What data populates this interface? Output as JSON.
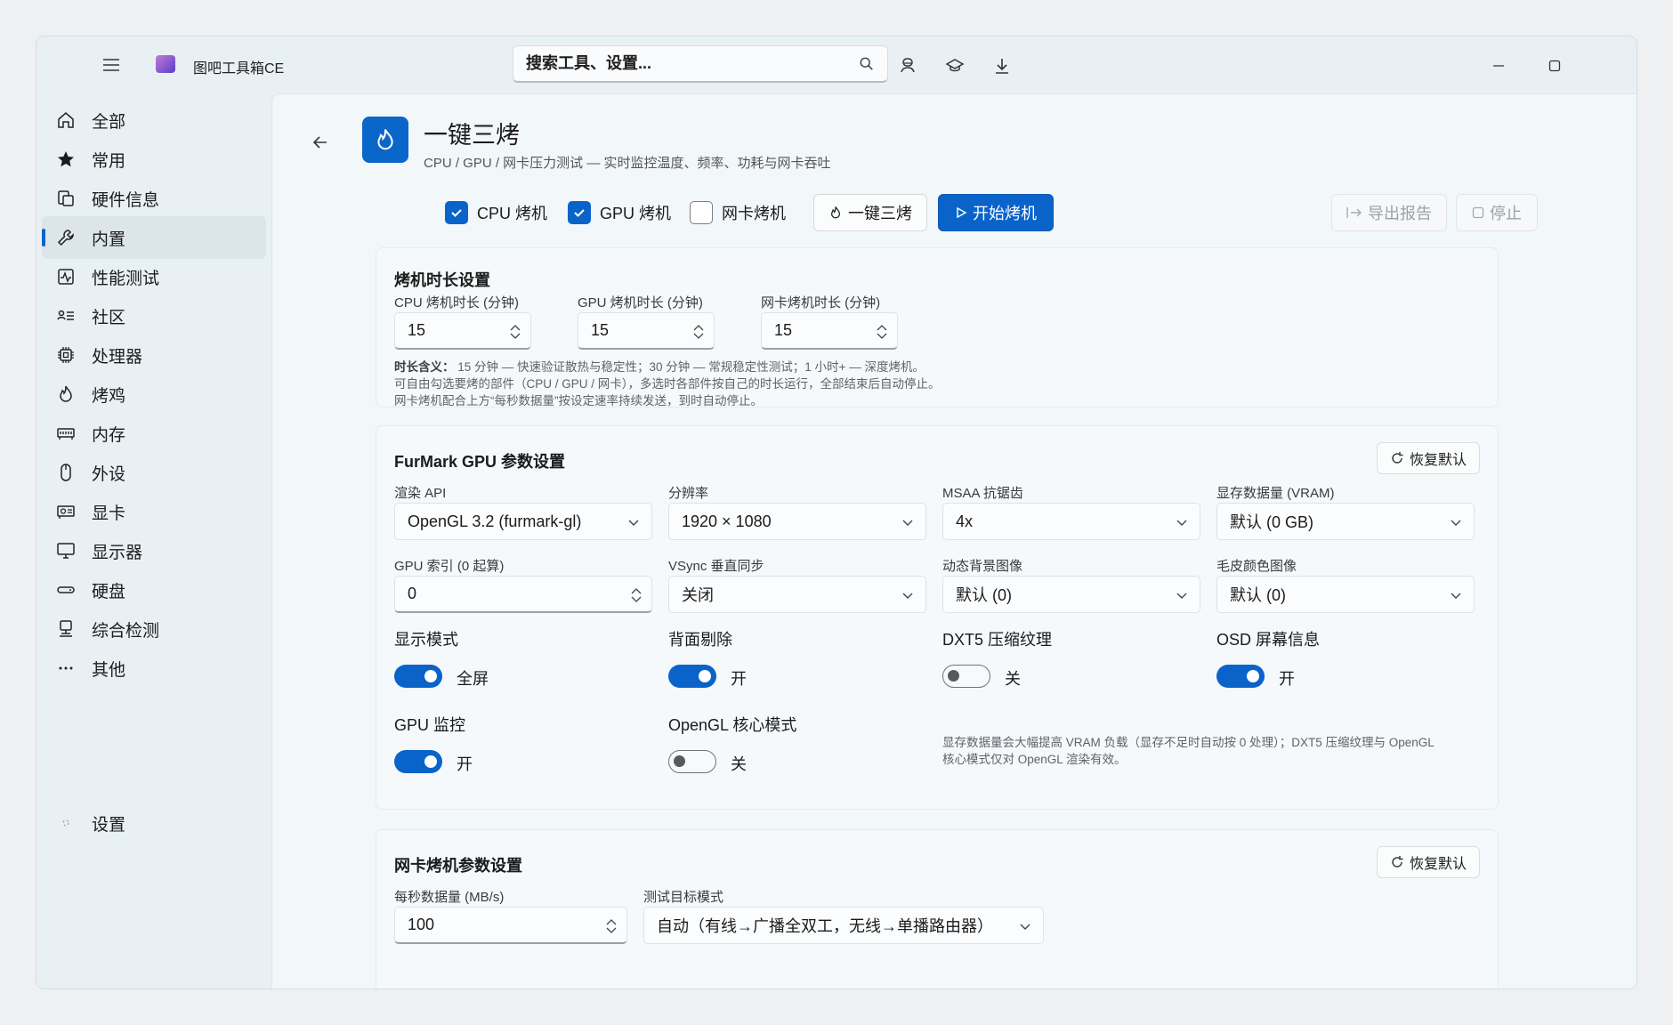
{
  "app": {
    "title": "图吧工具箱CE"
  },
  "search": {
    "placeholder": "搜索工具、设置..."
  },
  "sidebar": {
    "items": [
      {
        "label": "全部",
        "icon": "home-icon"
      },
      {
        "label": "常用",
        "icon": "star-icon"
      },
      {
        "label": "硬件信息",
        "icon": "hardware-info-icon"
      },
      {
        "label": "内置",
        "icon": "wrench-icon",
        "active": true
      },
      {
        "label": "性能测试",
        "icon": "performance-icon"
      },
      {
        "label": "社区",
        "icon": "community-icon"
      },
      {
        "label": "处理器",
        "icon": "cpu-icon"
      },
      {
        "label": "烤鸡",
        "icon": "flame-icon"
      },
      {
        "label": "内存",
        "icon": "memory-icon"
      },
      {
        "label": "外设",
        "icon": "mouse-icon"
      },
      {
        "label": "显卡",
        "icon": "gpu-icon"
      },
      {
        "label": "显示器",
        "icon": "monitor-icon"
      },
      {
        "label": "硬盘",
        "icon": "disk-icon"
      },
      {
        "label": "综合检测",
        "icon": "diagnostics-icon"
      },
      {
        "label": "其他",
        "icon": "more-icon"
      }
    ],
    "settings_label": "设置"
  },
  "page": {
    "title": "一键三烤",
    "subtitle": "CPU / GPU / 网卡压力测试 — 实时监控温度、频率、功耗与网卡吞吐"
  },
  "toolbar": {
    "cpu_label": "CPU 烤机",
    "cpu_checked": true,
    "gpu_label": "GPU 烤机",
    "gpu_checked": true,
    "net_label": "网卡烤机",
    "net_checked": false,
    "onekey_label": "一键三烤",
    "start_label": "开始烤机",
    "export_label": "导出报告",
    "stop_label": "停止"
  },
  "duration": {
    "title": "烤机时长设置",
    "cpu_label": "CPU 烤机时长 (分钟)",
    "cpu_value": "15",
    "gpu_label": "GPU 烤机时长 (分钟)",
    "gpu_value": "15",
    "net_label": "网卡烤机时长 (分钟)",
    "net_value": "15",
    "note_title": "时长含义：",
    "note_line1": "15 分钟 — 快速验证散热与稳定性；30 分钟 — 常规稳定性测试；1 小时+ — 深度烤机。",
    "note_line2": "可自由勾选要烤的部件（CPU / GPU / 网卡），多选时各部件按自己的时长运行，全部结束后自动停止。",
    "note_line3": "网卡烤机配合上方“每秒数据量”按设定速率持续发送，到时自动停止。"
  },
  "furmark": {
    "title": "FurMark GPU 参数设置",
    "reset_label": "恢复默认",
    "api_label": "渲染 API",
    "api_value": "OpenGL 3.2 (furmark-gl)",
    "res_label": "分辨率",
    "res_value": "1920 × 1080",
    "msaa_label": "MSAA 抗锯齿",
    "msaa_value": "4x",
    "vram_label": "显存数据量 (VRAM)",
    "vram_value": "默认 (0 GB)",
    "gpu_index_label": "GPU 索引 (0 起算)",
    "gpu_index_value": "0",
    "vsync_label": "VSync 垂直同步",
    "vsync_value": "关闭",
    "bg_label": "动态背景图像",
    "bg_value": "默认 (0)",
    "fur_label": "毛皮颜色图像",
    "fur_value": "默认 (0)",
    "display_mode_label": "显示模式",
    "display_mode_on": true,
    "display_mode_text": "全屏",
    "backface_label": "背面剔除",
    "backface_on": true,
    "backface_text": "开",
    "dxt5_label": "DXT5 压缩纹理",
    "dxt5_on": false,
    "dxt5_text": "关",
    "osd_label": "OSD 屏幕信息",
    "osd_on": true,
    "osd_text": "开",
    "gpu_monitor_label": "GPU 监控",
    "gpu_monitor_on": true,
    "gpu_monitor_text": "开",
    "opengl_core_label": "OpenGL 核心模式",
    "opengl_core_on": false,
    "opengl_core_text": "关",
    "note_line1": "显存数据量会大幅提高 VRAM 负载（显存不足时自动按 0 处理）；DXT5 压缩纹理与 OpenGL",
    "note_line2": "核心模式仅对 OpenGL 渲染有效。"
  },
  "network": {
    "title": "网卡烤机参数设置",
    "reset_label": "恢复默认",
    "rate_label": "每秒数据量 (MB/s)",
    "rate_value": "100",
    "target_label": "测试目标模式",
    "target_value": "自动（有线→广播全双工，无线→单播路由器）"
  },
  "colors": {
    "accent": "#0a63c9",
    "background": "#f2f7f9"
  }
}
